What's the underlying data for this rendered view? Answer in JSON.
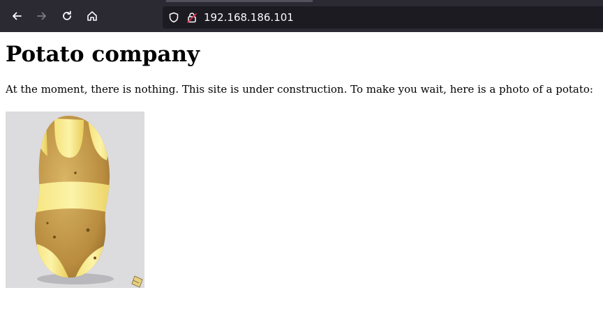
{
  "browser": {
    "url": "192.168.186.101",
    "icons": {
      "back": "arrow-left-icon",
      "forward": "arrow-right-icon",
      "reload": "reload-icon",
      "home": "home-icon",
      "tracking": "shield-icon",
      "insecure": "insecure-lock-icon"
    }
  },
  "page": {
    "heading": "Potato company",
    "paragraph": "At the moment, there is nothing. This site is under construction. To make you wait, here is a photo of a potato:",
    "image": {
      "subject": "potato wearing a bikini",
      "watermark_icon": "pencil-edit-icon"
    }
  },
  "colors": {
    "toolbar": "#2b2a33",
    "url_bar": "#1c1b22",
    "insecure_lock": "#e22850",
    "page_background": "#ffffff"
  }
}
